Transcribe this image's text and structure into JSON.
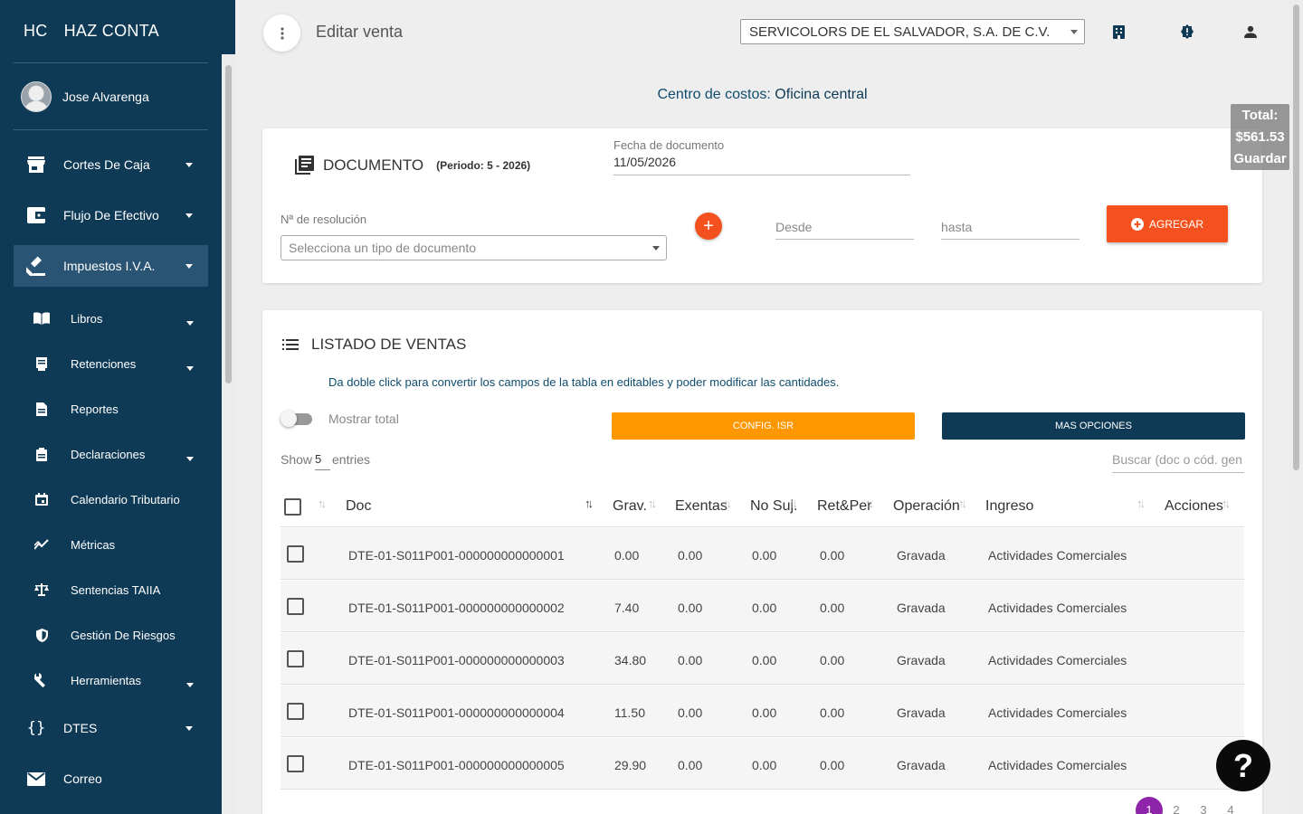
{
  "sidebar": {
    "brand_short": "HC",
    "brand_name": "HAZ CONTA",
    "user_name": "Jose Alvarenga",
    "items": [
      {
        "label": "Cortes De Caja",
        "icon": "store-icon"
      },
      {
        "label": "Flujo De Efectivo",
        "icon": "wallet-icon"
      },
      {
        "label": "Impuestos I.V.A.",
        "icon": "gavel-icon"
      },
      {
        "label": "DTES",
        "icon": "code-braces-icon"
      },
      {
        "label": "Correo",
        "icon": "mail-icon"
      }
    ],
    "subitems": [
      {
        "label": "Libros",
        "icon": "book-icon"
      },
      {
        "label": "Retenciones",
        "icon": "receipt-icon"
      },
      {
        "label": "Reportes",
        "icon": "document-icon"
      },
      {
        "label": "Declaraciones",
        "icon": "clipboard-icon"
      },
      {
        "label": "Calendario Tributario",
        "icon": "calendar-icon"
      },
      {
        "label": "Métricas",
        "icon": "trending-icon"
      },
      {
        "label": "Sentencias TAIIA",
        "icon": "scale-icon"
      },
      {
        "label": "Gestión De Riesgos",
        "icon": "shield-icon"
      },
      {
        "label": "Herramientas",
        "icon": "wrench-icon"
      }
    ]
  },
  "header": {
    "title": "Editar venta",
    "company": "SERVICOLORS DE EL SALVADOR, S.A. DE C.V.",
    "icons": [
      "building-icon",
      "alert-badge-icon",
      "account-icon"
    ]
  },
  "centro": {
    "label": "Centro de costos:",
    "value": "Oficina central"
  },
  "total_box": {
    "label": "Total:",
    "amount": "$561.53",
    "save": "Guardar"
  },
  "documento": {
    "title": "DOCUMENTO",
    "period": "(Periodo: 5 - 2026)",
    "fecha_label": "Fecha de documento",
    "fecha_value": "11/05/2026",
    "resolucion_label": "Nª de resolución",
    "resolucion_placeholder": "Selecciona un tipo de documento",
    "desde_placeholder": "Desde",
    "hasta_placeholder": "hasta",
    "add_label": "AGREGAR"
  },
  "listado": {
    "title": "LISTADO DE VENTAS",
    "hint": "Da doble click para convertir los campos de la tabla en editables y poder modificar las cantidades.",
    "toggle_label": "Mostrar total",
    "config_btn": "CONFIG. ISR",
    "more_btn": "MAS OPCIONES",
    "show_label": "Show",
    "show_value": "5",
    "entries_label": "entries",
    "search_placeholder": "Buscar (doc o cód. gen",
    "columns": [
      "Doc",
      "Grav.",
      "Exentas",
      "No Suj.",
      "Ret&Per",
      "Operación",
      "Ingreso",
      "Acciones"
    ],
    "rows": [
      {
        "doc": "DTE-01-S011P001-000000000000001",
        "grav": "0.00",
        "exentas": "0.00",
        "nosuj": "0.00",
        "retper": "0.00",
        "operacion": "Gravada",
        "ingreso": "Actividades Comerciales"
      },
      {
        "doc": "DTE-01-S011P001-000000000000002",
        "grav": "7.40",
        "exentas": "0.00",
        "nosuj": "0.00",
        "retper": "0.00",
        "operacion": "Gravada",
        "ingreso": "Actividades Comerciales"
      },
      {
        "doc": "DTE-01-S011P001-000000000000003",
        "grav": "34.80",
        "exentas": "0.00",
        "nosuj": "0.00",
        "retper": "0.00",
        "operacion": "Gravada",
        "ingreso": "Actividades Comerciales"
      },
      {
        "doc": "DTE-01-S011P001-000000000000004",
        "grav": "11.50",
        "exentas": "0.00",
        "nosuj": "0.00",
        "retper": "0.00",
        "operacion": "Gravada",
        "ingreso": "Actividades Comerciales"
      },
      {
        "doc": "DTE-01-S011P001-000000000000005",
        "grav": "29.90",
        "exentas": "0.00",
        "nosuj": "0.00",
        "retper": "0.00",
        "operacion": "Gravada",
        "ingreso": "Actividades Comerciales"
      }
    ],
    "pages": [
      "1",
      "2",
      "3",
      "4"
    ]
  },
  "help_label": "?"
}
